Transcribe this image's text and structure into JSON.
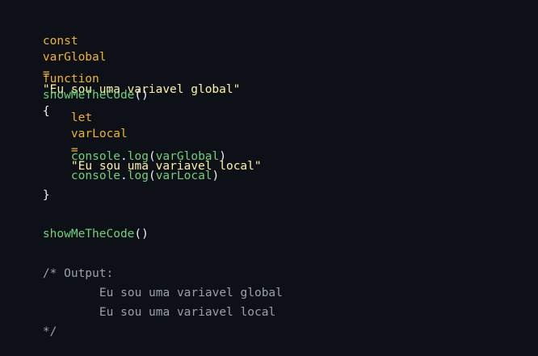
{
  "code": {
    "line1": {
      "keyword": "const",
      "name": "varGlobal",
      "operator": "=",
      "value": "\"Eu sou uma variavel global\""
    },
    "line2": {
      "keyword": "function",
      "name": "showMeTheCode",
      "parens": "()",
      "brace": "{"
    },
    "line3": {
      "keyword": "let",
      "name": "varLocal",
      "operator": "=",
      "value": "\"Eu sou uma variavel local\""
    },
    "line4": {
      "object": "console",
      "dot": ".",
      "method": "log",
      "open": "(",
      "arg": "varGlobal",
      "close": ")"
    },
    "line5": {
      "object": "console",
      "dot": ".",
      "method": "log",
      "open": "(",
      "arg": "varLocal",
      "close": ")"
    },
    "line6": {
      "brace": "}"
    },
    "line7": {
      "name": "showMeTheCode",
      "parens": "()"
    },
    "comment": {
      "start": "/* Output:",
      "out1": "Eu sou uma variavel global",
      "out2": "Eu sou uma variavel local",
      "end": "*/"
    }
  }
}
